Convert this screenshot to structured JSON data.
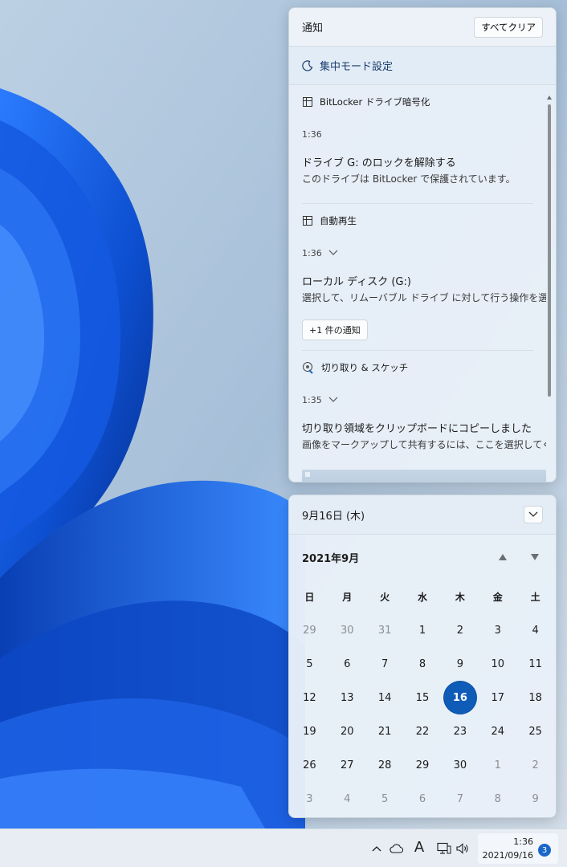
{
  "notifications": {
    "title": "通知",
    "clear_all": "すべてクリア",
    "focus_assist": "集中モード設定",
    "groups": [
      {
        "app": "BitLocker ドライブ暗号化",
        "time": "1:36",
        "title": "ドライブ G: のロックを解除する",
        "body": "このドライブは BitLocker で保護されています。"
      },
      {
        "app": "自動再生",
        "time": "1:36",
        "title": "ローカル ディスク (G:)",
        "body": "選択して、リムーバブル ドライブ に対して行う操作を選んでください。",
        "more": "+1 件の通知"
      },
      {
        "app": "切り取り & スケッチ",
        "time": "1:35",
        "title": "切り取り領域をクリップボードにコピーしました",
        "body": "画像をマークアップして共有するには、ここを選択してください。"
      }
    ]
  },
  "calendar": {
    "date_header": "9月16日 (木)",
    "month_label": "2021年9月",
    "weekdays": [
      "日",
      "月",
      "火",
      "水",
      "木",
      "金",
      "土"
    ],
    "weeks": [
      [
        29,
        30,
        31,
        1,
        2,
        3,
        4
      ],
      [
        5,
        6,
        7,
        8,
        9,
        10,
        11
      ],
      [
        12,
        13,
        14,
        15,
        16,
        17,
        18
      ],
      [
        19,
        20,
        21,
        22,
        23,
        24,
        25
      ],
      [
        26,
        27,
        28,
        29,
        30,
        1,
        2
      ],
      [
        3,
        4,
        5,
        6,
        7,
        8,
        9
      ]
    ],
    "today": 16
  },
  "taskbar": {
    "ime": "A",
    "time": "1:36",
    "date": "2021/09/16",
    "badge": "3"
  },
  "colors": {
    "accent": "#0f5cb8",
    "badge": "#1a66c9",
    "wallpaper_blue": "#1f5fd6"
  }
}
